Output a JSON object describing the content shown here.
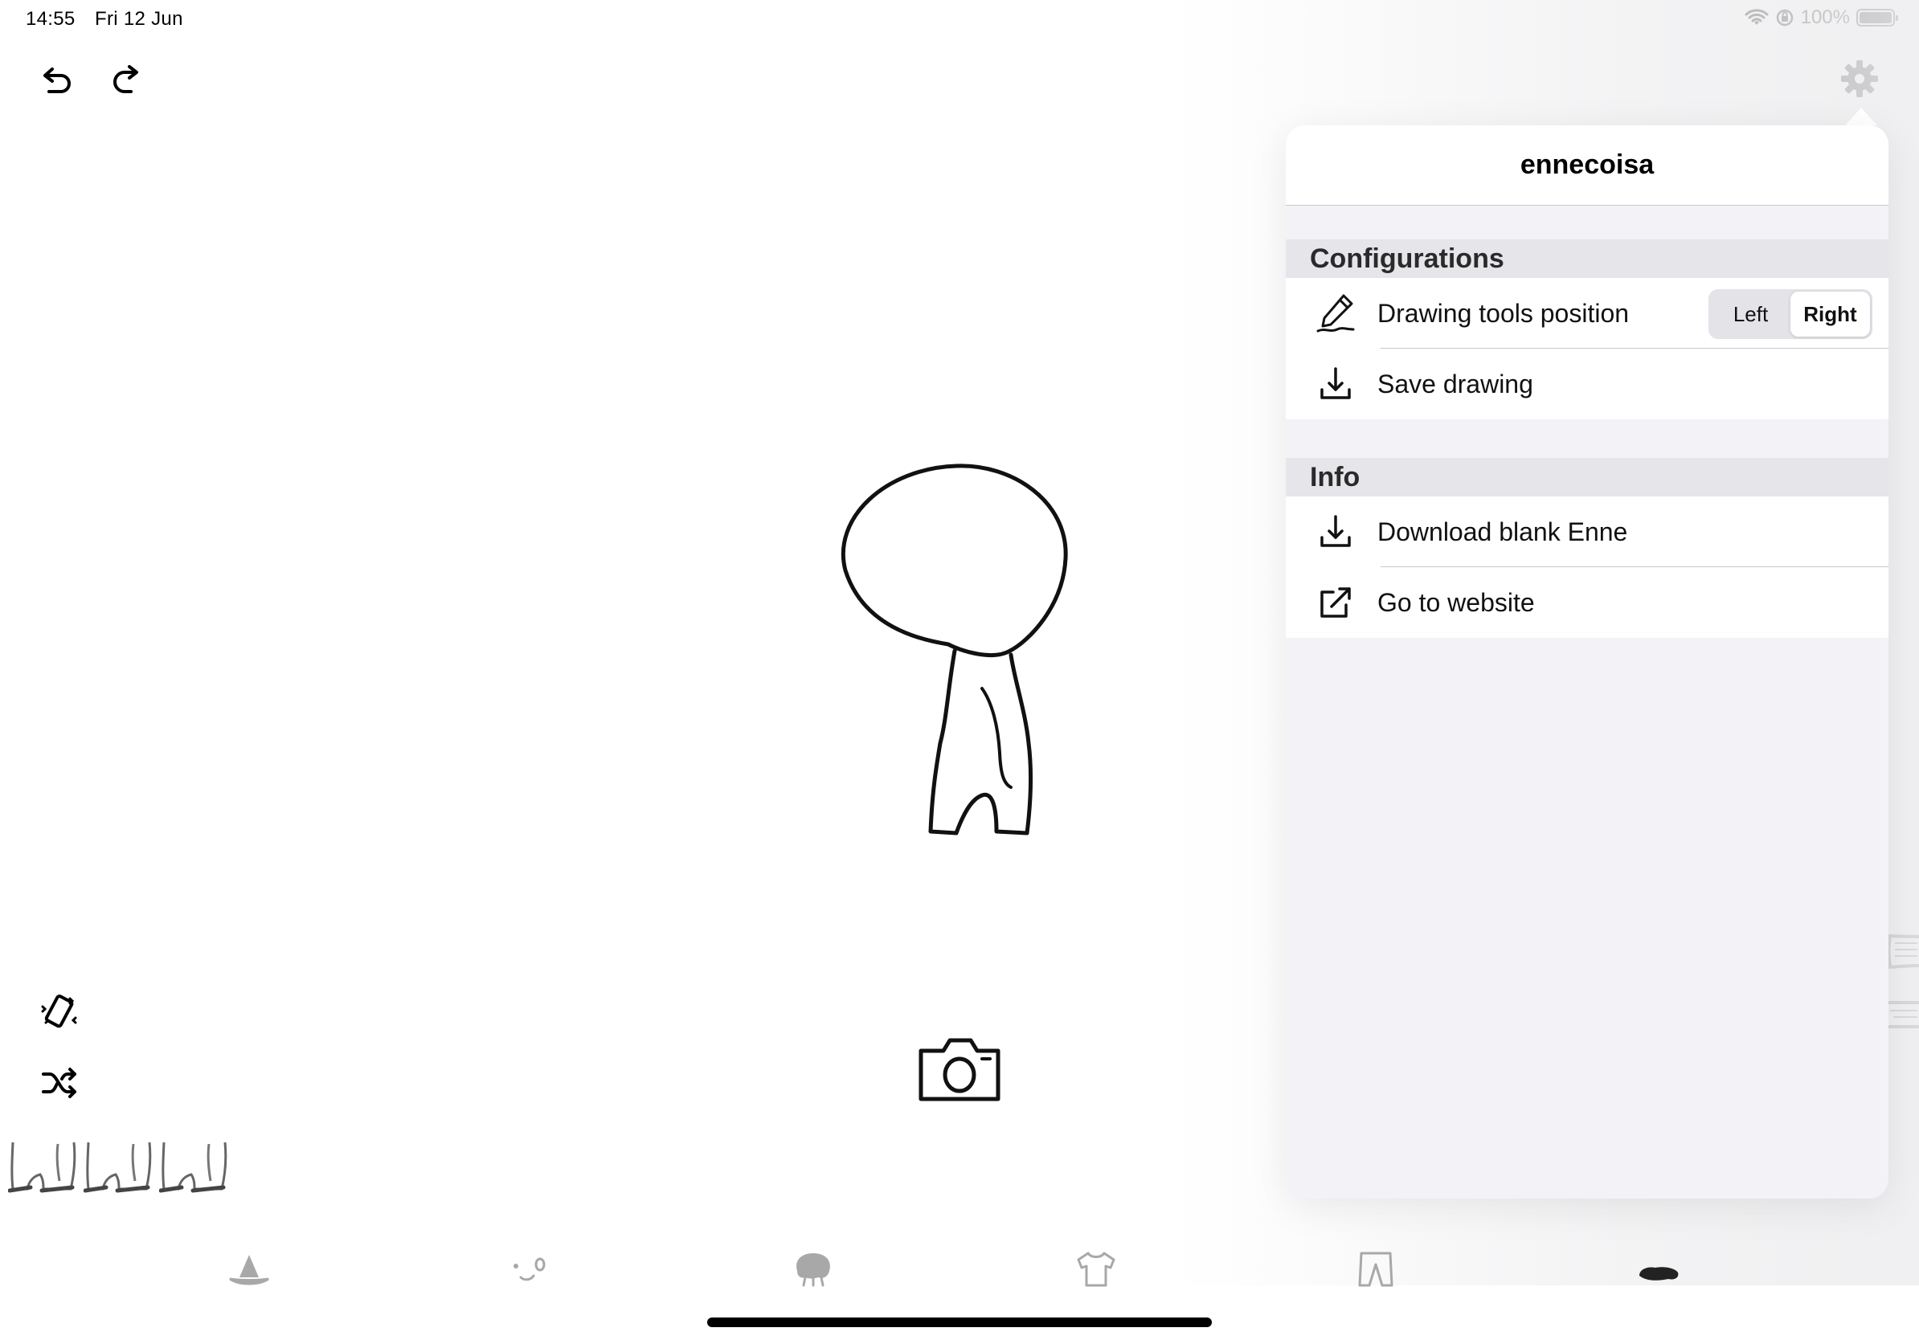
{
  "status_bar": {
    "time": "14:55",
    "date": "Fri 12 Jun",
    "battery_percent": "100%",
    "icons": [
      "wifi-icon",
      "orientation-lock-icon",
      "battery-icon"
    ]
  },
  "toolbar": {
    "undo_icon": "undo-icon",
    "redo_icon": "redo-icon",
    "settings_icon": "gear-icon"
  },
  "popover": {
    "title": "ennecoisa",
    "sections": [
      {
        "header": "Configurations",
        "rows": [
          {
            "icon": "pencil-icon",
            "label": "Drawing tools position",
            "segmented": {
              "options": [
                "Left",
                "Right"
              ],
              "selected": "Right"
            }
          },
          {
            "icon": "download-icon",
            "label": "Save drawing"
          }
        ]
      },
      {
        "header": "Info",
        "rows": [
          {
            "icon": "download-icon",
            "label": "Download blank Enne"
          },
          {
            "icon": "external-link-icon",
            "label": "Go to website"
          }
        ]
      }
    ]
  },
  "side_tools": [
    "vibrate-icon",
    "shuffle-icon"
  ],
  "legs_thumbnails": 3,
  "tabs": [
    {
      "name": "hat",
      "icon": "hat-icon",
      "active": false
    },
    {
      "name": "face",
      "icon": "face-icon",
      "active": false
    },
    {
      "name": "hair",
      "icon": "hair-icon",
      "active": false
    },
    {
      "name": "shirt",
      "icon": "shirt-icon",
      "active": false
    },
    {
      "name": "pants",
      "icon": "pants-icon",
      "active": false
    },
    {
      "name": "shoes",
      "icon": "shoes-icon",
      "active": true
    }
  ],
  "colors": {
    "tab_inactive": "#a0a0a0",
    "tab_active": "#222222",
    "popover_bg": "#f2f2f7",
    "section_header_bg": "#e5e5ea"
  }
}
